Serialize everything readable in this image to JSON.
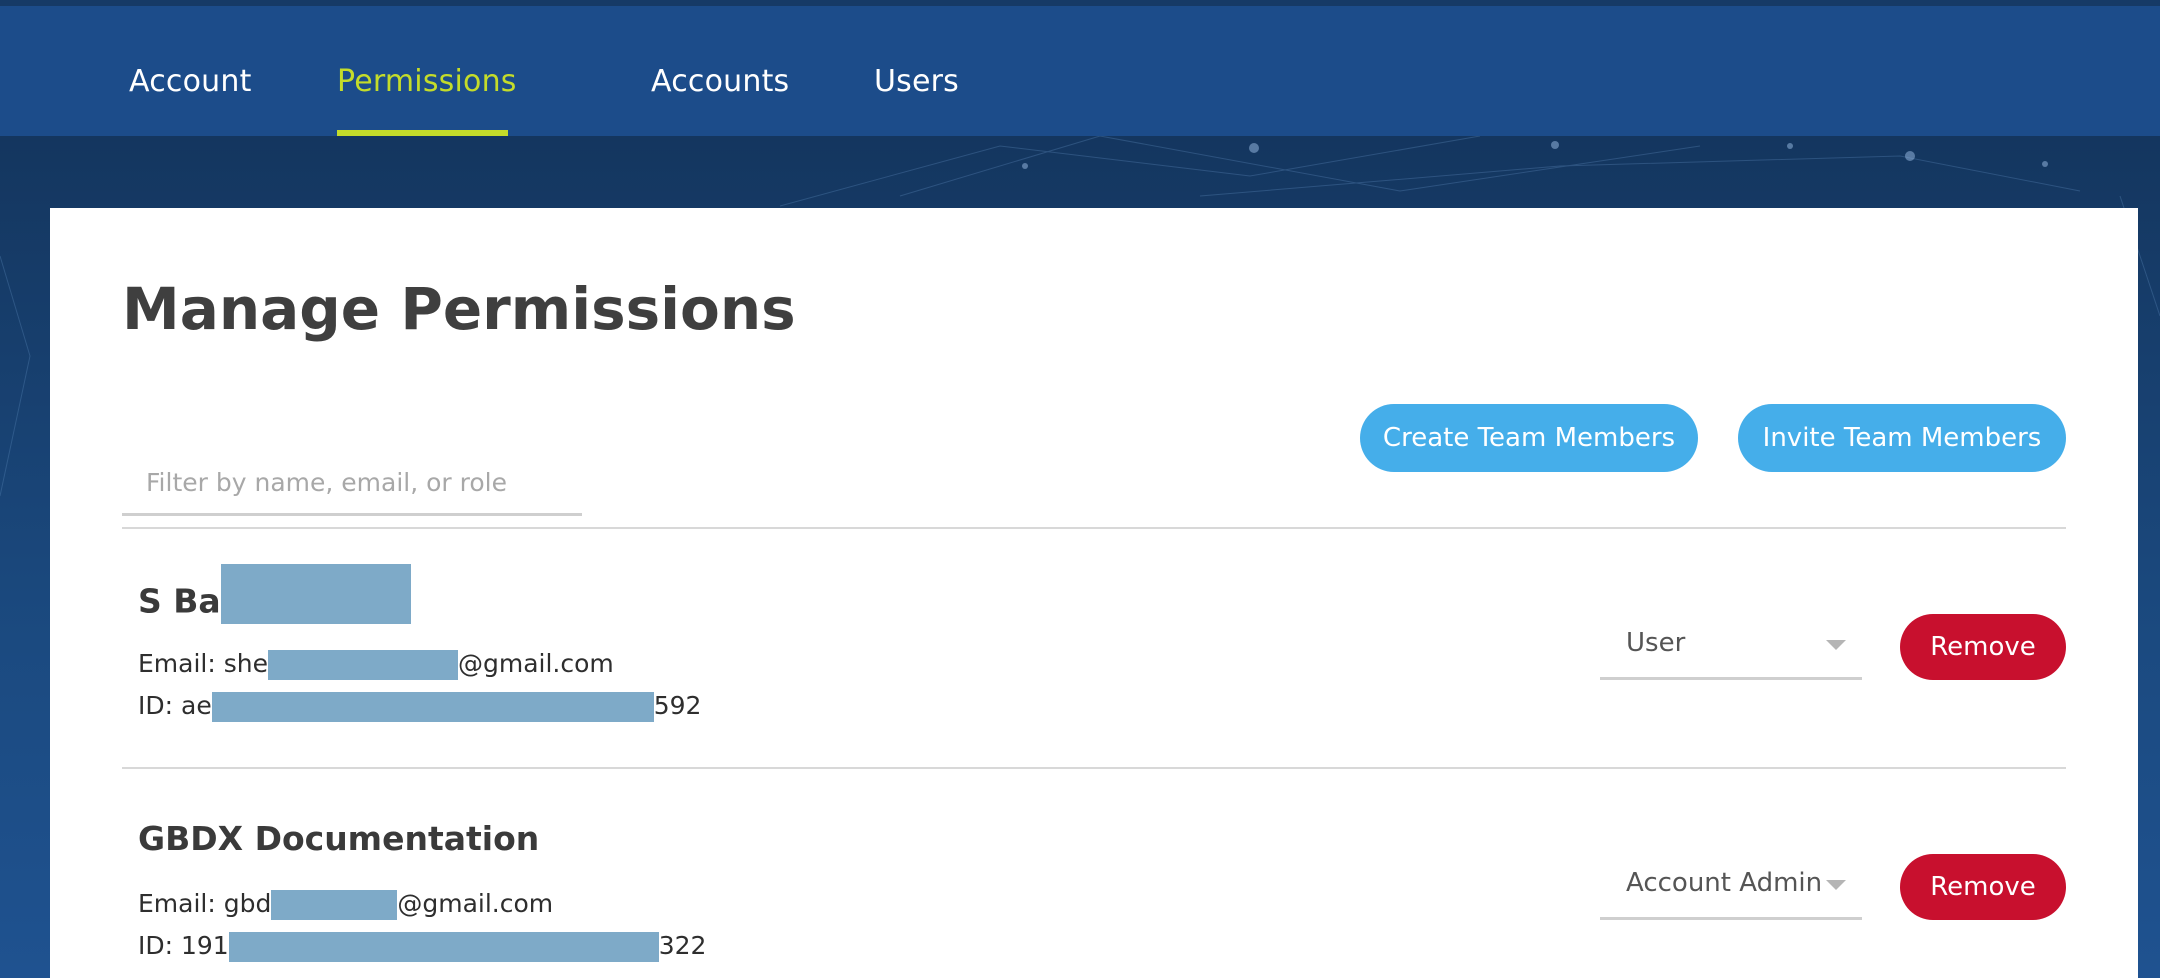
{
  "nav": {
    "tabs": [
      {
        "label": "Account"
      },
      {
        "label": "Permissions",
        "active": true
      },
      {
        "label": "Accounts"
      },
      {
        "label": "Users"
      }
    ]
  },
  "main": {
    "title": "Manage Permissions",
    "filter_placeholder": "Filter by name, email, or role",
    "create_button": "Create Team Members",
    "invite_button": "Invite Team Members"
  },
  "members": [
    {
      "name": "S Ba",
      "email_label": "Email: ",
      "email_prefix": "she",
      "email_suffix": "@gmail.com",
      "id_label": "ID: ",
      "id_prefix": "ae",
      "id_suffix": "592",
      "role": "User",
      "remove_label": "Remove"
    },
    {
      "name": "GBDX Documentation",
      "email_label": "Email: ",
      "email_prefix": "gbd",
      "email_suffix": "@gmail.com",
      "id_label": "ID: ",
      "id_prefix": "191",
      "id_suffix": "322",
      "role": "Account Admin",
      "remove_label": "Remove"
    }
  ],
  "colors": {
    "nav_bg": "#1c4c8a",
    "active_tab": "#c4dc2a",
    "primary_button": "#45aeea",
    "remove_button": "#c8102e",
    "redaction": "#7eaac8"
  }
}
